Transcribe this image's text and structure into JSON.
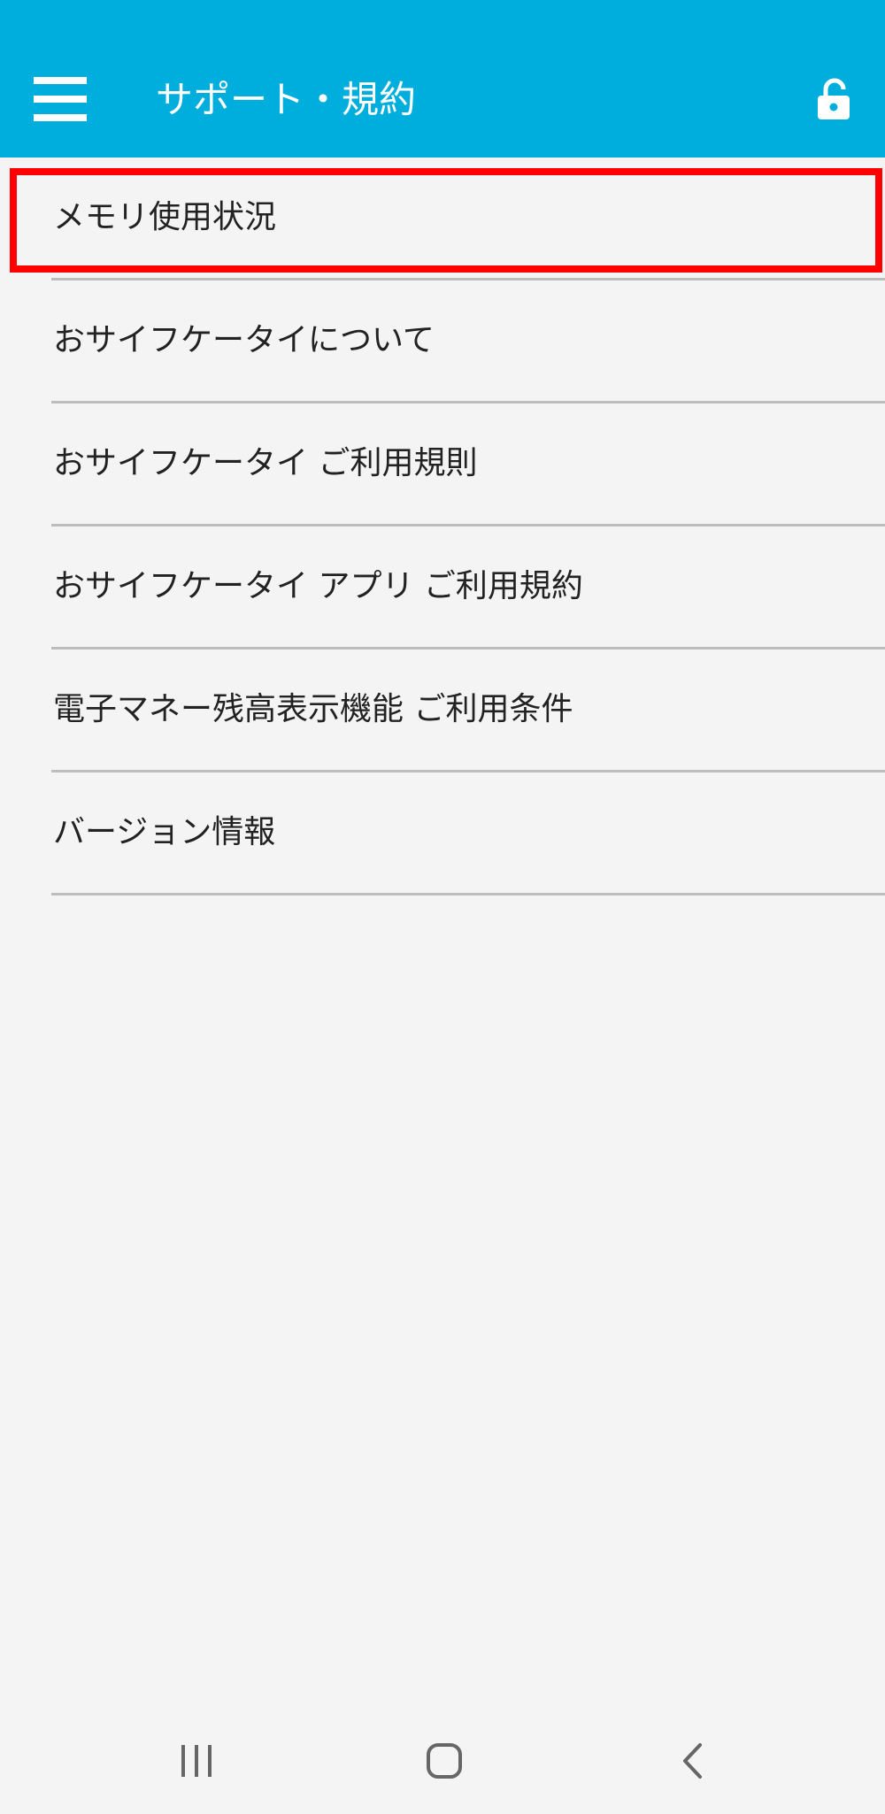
{
  "header": {
    "title": "サポート・規約",
    "background_color": "#00aedd",
    "menu_icon": "hamburger-menu-icon",
    "lock_icon": "unlock-icon"
  },
  "menu": {
    "items": [
      {
        "label": "メモリ使用状況",
        "highlighted": true
      },
      {
        "label": "おサイフケータイについて"
      },
      {
        "label": "おサイフケータイ ご利用規則"
      },
      {
        "label": "おサイフケータイ アプリ ご利用規約"
      },
      {
        "label": "電子マネー残高表示機能 ご利用条件"
      },
      {
        "label": "バージョン情報"
      }
    ],
    "highlight_color": "#ff0000"
  },
  "navigation": {
    "icons": [
      "recent-apps-icon",
      "home-icon",
      "back-icon"
    ]
  }
}
